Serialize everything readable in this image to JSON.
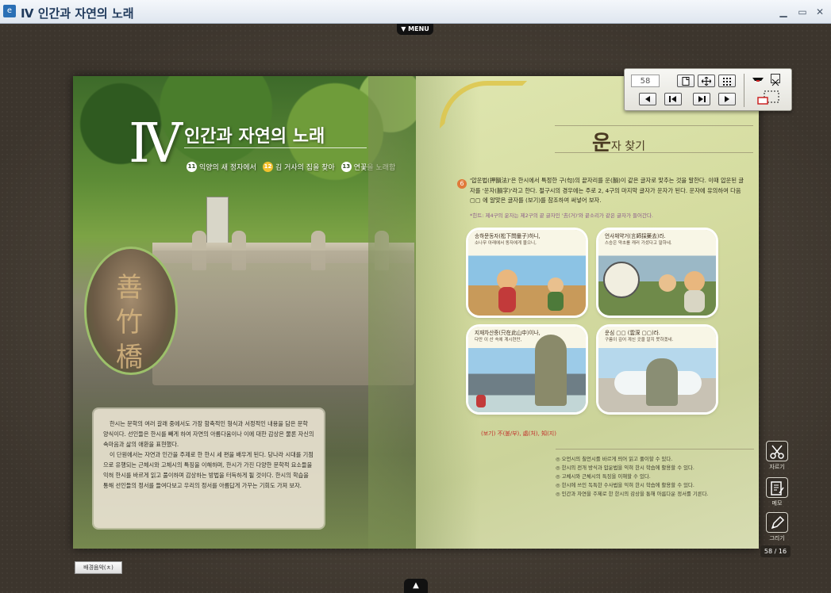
{
  "window": {
    "title": "Ⅳ 인간과 자연의 노래",
    "minimize": "▁",
    "maximize": "▭",
    "close": "✕"
  },
  "top_menu_label": "▼ MENU",
  "bottom_toggle_label": "▲",
  "left_page": {
    "roman_numeral": "Ⅳ",
    "unit_title": "인간과 자연의 노래",
    "lessons": [
      {
        "num": "11",
        "title": "익양의 새 정자에서"
      },
      {
        "num": "12",
        "title": "김 거사의 집을 찾아"
      },
      {
        "num": "13",
        "title": "연꽃을 노래함"
      }
    ],
    "stone_inscription": "善竹橋",
    "intro_paragraphs": [
      "한시는 문학의 여러 갈래 중에서도 가장 함축적인 형식과 서정적인 내용을 담은 문학 양식이다. 선인들은 한시를 빼게 하여 자연의 아름다움이나 이에 대한 감상은 물론 자신의 속마음과 삶의 애환을 표현했다.",
      "이 단원에서는 자연과 인간을 주제로 한 한시 세 편을 배우게 된다. 당나라 시대를 기점으로 유행되는 근체시와 고체시의 특징을 이해하며, 한시가 가진 다양한 문학적 요소들을 익혀 한시를 바르게 읽고 풀이하며 감상하는 방법을 터득하게 될 것이다. 한시의 학습을 통해 선인들의 정서를 들여다보고 우리의 정서를 아름답게 가꾸는 기회도 가져 보자."
    ]
  },
  "right_page": {
    "section_title_big": "운",
    "section_title_rest": "자 찾기",
    "question_badge": "6",
    "question": "'압운법(押韻法)'은 한시에서 특정한 구(句)의 끝자리를 운(韻)이 같은 글자로 맞추는 것을 말한다. 이때 압운된 글자를 '운자(韻字)'라고 한다. 절구시의 경우에는 주로 2, 4구의 마지막 글자가 운자가 된다. 운자에 유의하여 다음 ▢▢ 에 알맞은 글자를 (보기)를 참조하여 써넣어 보자.",
    "hint": "*힌트: 제4구의 운자는 제2구의 끝 글자인 '去(거)'와 끝소리가 같은 글자가 들어간다.",
    "panels": [
      {
        "caption": "송하문동자(松下問童子)하니,",
        "sub": "소나무 아래에서 동자에게 물으니,"
      },
      {
        "caption": "언사채약거(言師採藥去)라.",
        "sub": "스승은 약초를 캐러 가셨다고 말하네."
      },
      {
        "caption": "지재차산중(只在此山中)이나,",
        "sub": "다만 이 산 속에 계시련만,"
      },
      {
        "caption": "운심 ▢▢ (雲深 ▢▢)라.",
        "sub": "구름이 깊어 계신 곳을 알지 못하겠네."
      }
    ],
    "answer_options": "(보기) 不(불/부), 處(처), 知(지)",
    "objectives": [
      "◎ 오언시의 칠언시를 바르게 띄어 읽고 풀이할 수 있다.",
      "◎ 한시의 전개 방식과 압운법을 익혀 한시 학습에 활용할 수 있다.",
      "◎ 고체시와 근체시의 특징을 이해할 수 있다.",
      "◎ 한시에 쓰인 독특한 수사법을 익혀 한시 학습에 활용할 수 있다.",
      "◎ 인간과 자연을 주제로 한 한시의 감상을 통해 아름다운 정서를 기른다."
    ]
  },
  "navigator": {
    "page_value": "58",
    "buttons": [
      "single-page",
      "fit-page",
      "thumbnails",
      "prev",
      "first",
      "last",
      "next",
      "bookmark",
      "close",
      "search"
    ]
  },
  "tools": [
    {
      "label": "자르기",
      "icon": "scissors-icon"
    },
    {
      "label": "메모",
      "icon": "memo-icon"
    },
    {
      "label": "그리기",
      "icon": "pen-icon"
    }
  ],
  "page_counter": "58 / 16",
  "bgm_button": "배경음악(ㅊ)"
}
